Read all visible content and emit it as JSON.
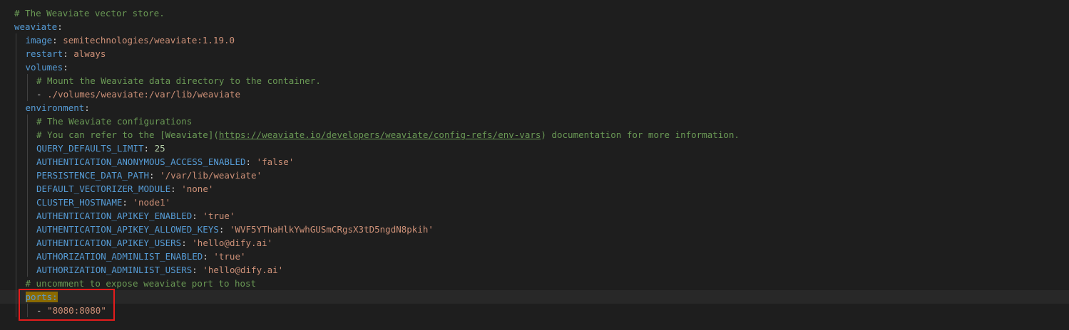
{
  "editor": {
    "lines": [
      {
        "indent": 0,
        "comment": "# The Weaviate vector store."
      },
      {
        "indent": 0,
        "key": "weaviate",
        "sep": ":"
      },
      {
        "indent": 1,
        "key": "image",
        "sep": ": ",
        "value": "semitechnologies/weaviate:1.19.0",
        "vtype": "s"
      },
      {
        "indent": 1,
        "key": "restart",
        "sep": ": ",
        "value": "always",
        "vtype": "s"
      },
      {
        "indent": 1,
        "key": "volumes",
        "sep": ":"
      },
      {
        "indent": 2,
        "comment": "# Mount the Weaviate data directory to the container."
      },
      {
        "indent": 2,
        "dash": "- ",
        "value": "./volumes/weaviate:/var/lib/weaviate",
        "vtype": "s"
      },
      {
        "indent": 1,
        "key": "environment",
        "sep": ":"
      },
      {
        "indent": 2,
        "comment": "# The Weaviate configurations"
      },
      {
        "indent": 2,
        "comment": "# You can refer to the [Weaviate](",
        "link": "https://weaviate.io/developers/weaviate/config-refs/env-vars",
        "comment_tail": ") documentation for more information."
      },
      {
        "indent": 2,
        "key": "QUERY_DEFAULTS_LIMIT",
        "sep": ": ",
        "value": "25",
        "vtype": "n"
      },
      {
        "indent": 2,
        "key": "AUTHENTICATION_ANONYMOUS_ACCESS_ENABLED",
        "sep": ": ",
        "value": "'false'",
        "vtype": "s"
      },
      {
        "indent": 2,
        "key": "PERSISTENCE_DATA_PATH",
        "sep": ": ",
        "value": "'/var/lib/weaviate'",
        "vtype": "s"
      },
      {
        "indent": 2,
        "key": "DEFAULT_VECTORIZER_MODULE",
        "sep": ": ",
        "value": "'none'",
        "vtype": "s"
      },
      {
        "indent": 2,
        "key": "CLUSTER_HOSTNAME",
        "sep": ": ",
        "value": "'node1'",
        "vtype": "s"
      },
      {
        "indent": 2,
        "key": "AUTHENTICATION_APIKEY_ENABLED",
        "sep": ": ",
        "value": "'true'",
        "vtype": "s"
      },
      {
        "indent": 2,
        "key": "AUTHENTICATION_APIKEY_ALLOWED_KEYS",
        "sep": ": ",
        "value": "'WVF5YThaHlkYwhGUSmCRgsX3tD5ngdN8pkih'",
        "vtype": "s"
      },
      {
        "indent": 2,
        "key": "AUTHENTICATION_APIKEY_USERS",
        "sep": ": ",
        "value": "'hello@dify.ai'",
        "vtype": "s"
      },
      {
        "indent": 2,
        "key": "AUTHORIZATION_ADMINLIST_ENABLED",
        "sep": ": ",
        "value": "'true'",
        "vtype": "s"
      },
      {
        "indent": 2,
        "key": "AUTHORIZATION_ADMINLIST_USERS",
        "sep": ": ",
        "value": "'hello@dify.ai'",
        "vtype": "s"
      },
      {
        "indent": 1,
        "comment": "# uncomment to expose weaviate port to host"
      },
      {
        "indent": 1,
        "key": "ports",
        "sep": ":",
        "highlight": true,
        "current": true
      },
      {
        "indent": 2,
        "dash": "- ",
        "value": "\"8080:8080\"",
        "vtype": "s"
      }
    ]
  },
  "colors": {
    "background": "#1e1e1e",
    "key": "#569cd6",
    "comment": "#6a9955",
    "string": "#ce9178",
    "number": "#b5cea8",
    "highlight": "#8a6a00",
    "annotation_border": "#e51c1c"
  }
}
